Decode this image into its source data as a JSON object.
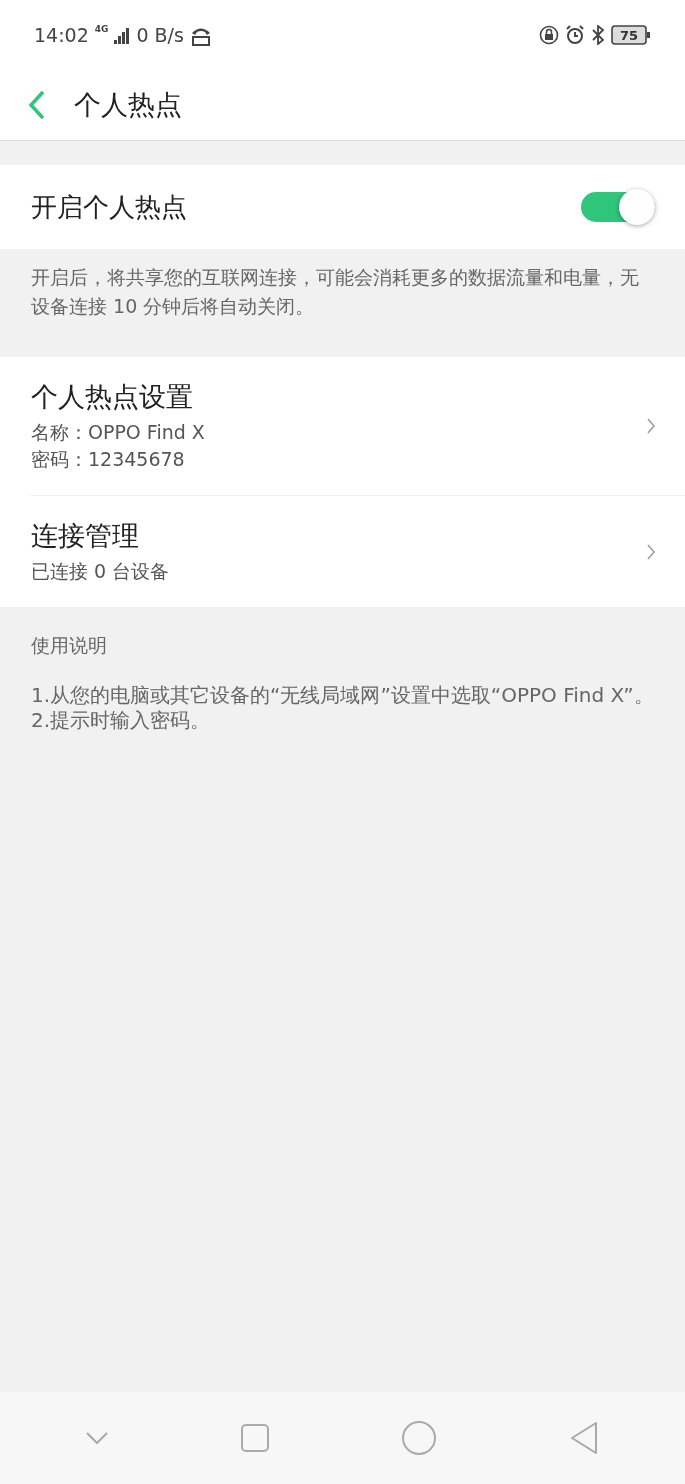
{
  "status_bar": {
    "time": "14:02",
    "network": "4G",
    "speed": "0 B/s",
    "battery": "75"
  },
  "header": {
    "title": "个人热点"
  },
  "hotspot_toggle": {
    "label": "开启个人热点",
    "on": true
  },
  "description": "开启后，将共享您的互联网连接，可能会消耗更多的数据流量和电量，无设备连接 10 分钟后将自动关闭。",
  "settings": [
    {
      "title": "个人热点设置",
      "lines": [
        "名称：OPPO Find X",
        "密码：12345678"
      ]
    },
    {
      "title": "连接管理",
      "lines": [
        "已连接 0 台设备"
      ]
    }
  ],
  "usage": {
    "heading": "使用说明",
    "steps": [
      "1.从您的电脑或其它设备的“无线局域网”设置中选取“OPPO Find X”。",
      "2.提示时输入密码。"
    ]
  }
}
